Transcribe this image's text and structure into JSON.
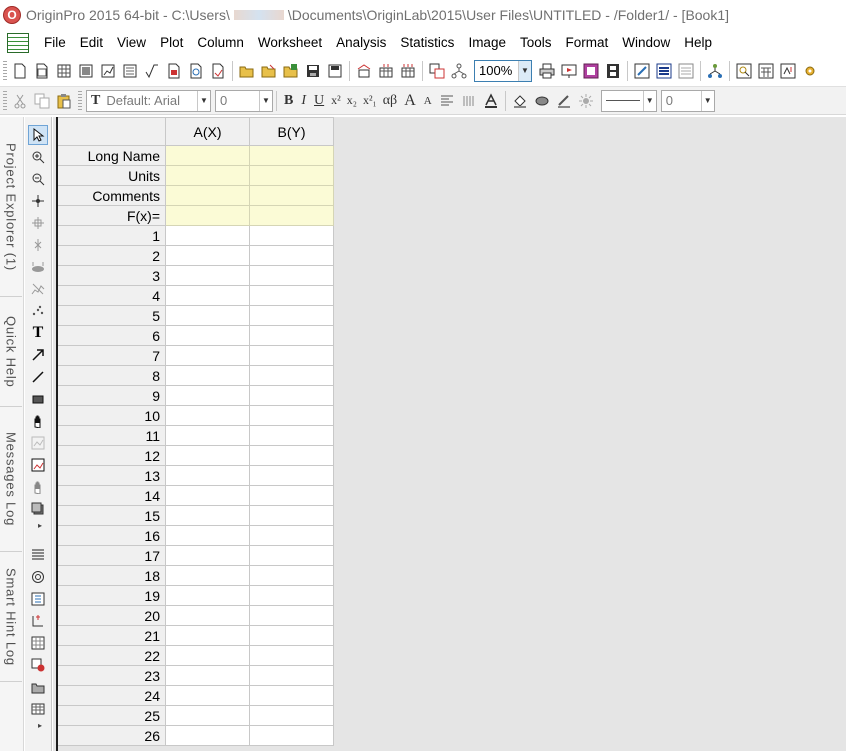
{
  "window": {
    "title_prefix": "OriginPro 2015 64-bit - C:\\Users\\",
    "title_suffix": "\\Documents\\OriginLab\\2015\\User Files\\UNTITLED - /Folder1/ - [Book1]",
    "app_icon_letter": "O"
  },
  "menu": {
    "items": [
      "File",
      "Edit",
      "View",
      "Plot",
      "Column",
      "Worksheet",
      "Analysis",
      "Statistics",
      "Image",
      "Tools",
      "Format",
      "Window",
      "Help"
    ]
  },
  "toolbar1": {
    "zoom": "100%"
  },
  "toolbar2": {
    "font_icon": "T",
    "font": "Default: Arial",
    "font_size": "0",
    "bold": "B",
    "italic": "I",
    "underline": "U",
    "superscript": "x²",
    "subscript": "x₂",
    "supsub": "x²₁",
    "greek": "αβ",
    "increase_font": "A",
    "decrease_font": "A",
    "line_width": "0"
  },
  "dock": {
    "tabs": [
      "Project Explorer (1)",
      "Quick Help",
      "Messages Log",
      "Smart Hint Log"
    ]
  },
  "worksheet": {
    "columns": [
      "A(X)",
      "B(Y)"
    ],
    "label_rows": [
      "Long Name",
      "Units",
      "Comments",
      "F(x)="
    ],
    "rows": [
      "1",
      "2",
      "3",
      "4",
      "5",
      "6",
      "7",
      "8",
      "9",
      "10",
      "11",
      "12",
      "13",
      "14",
      "15",
      "16",
      "17",
      "18",
      "19",
      "20",
      "21",
      "22",
      "23",
      "24",
      "25",
      "26"
    ]
  },
  "colors": {
    "label_row_bg": "#fbfbd6",
    "header_bg": "#f0f0f0",
    "workspace_bg": "#e5e5e5",
    "accent": "#3c7fb1"
  }
}
